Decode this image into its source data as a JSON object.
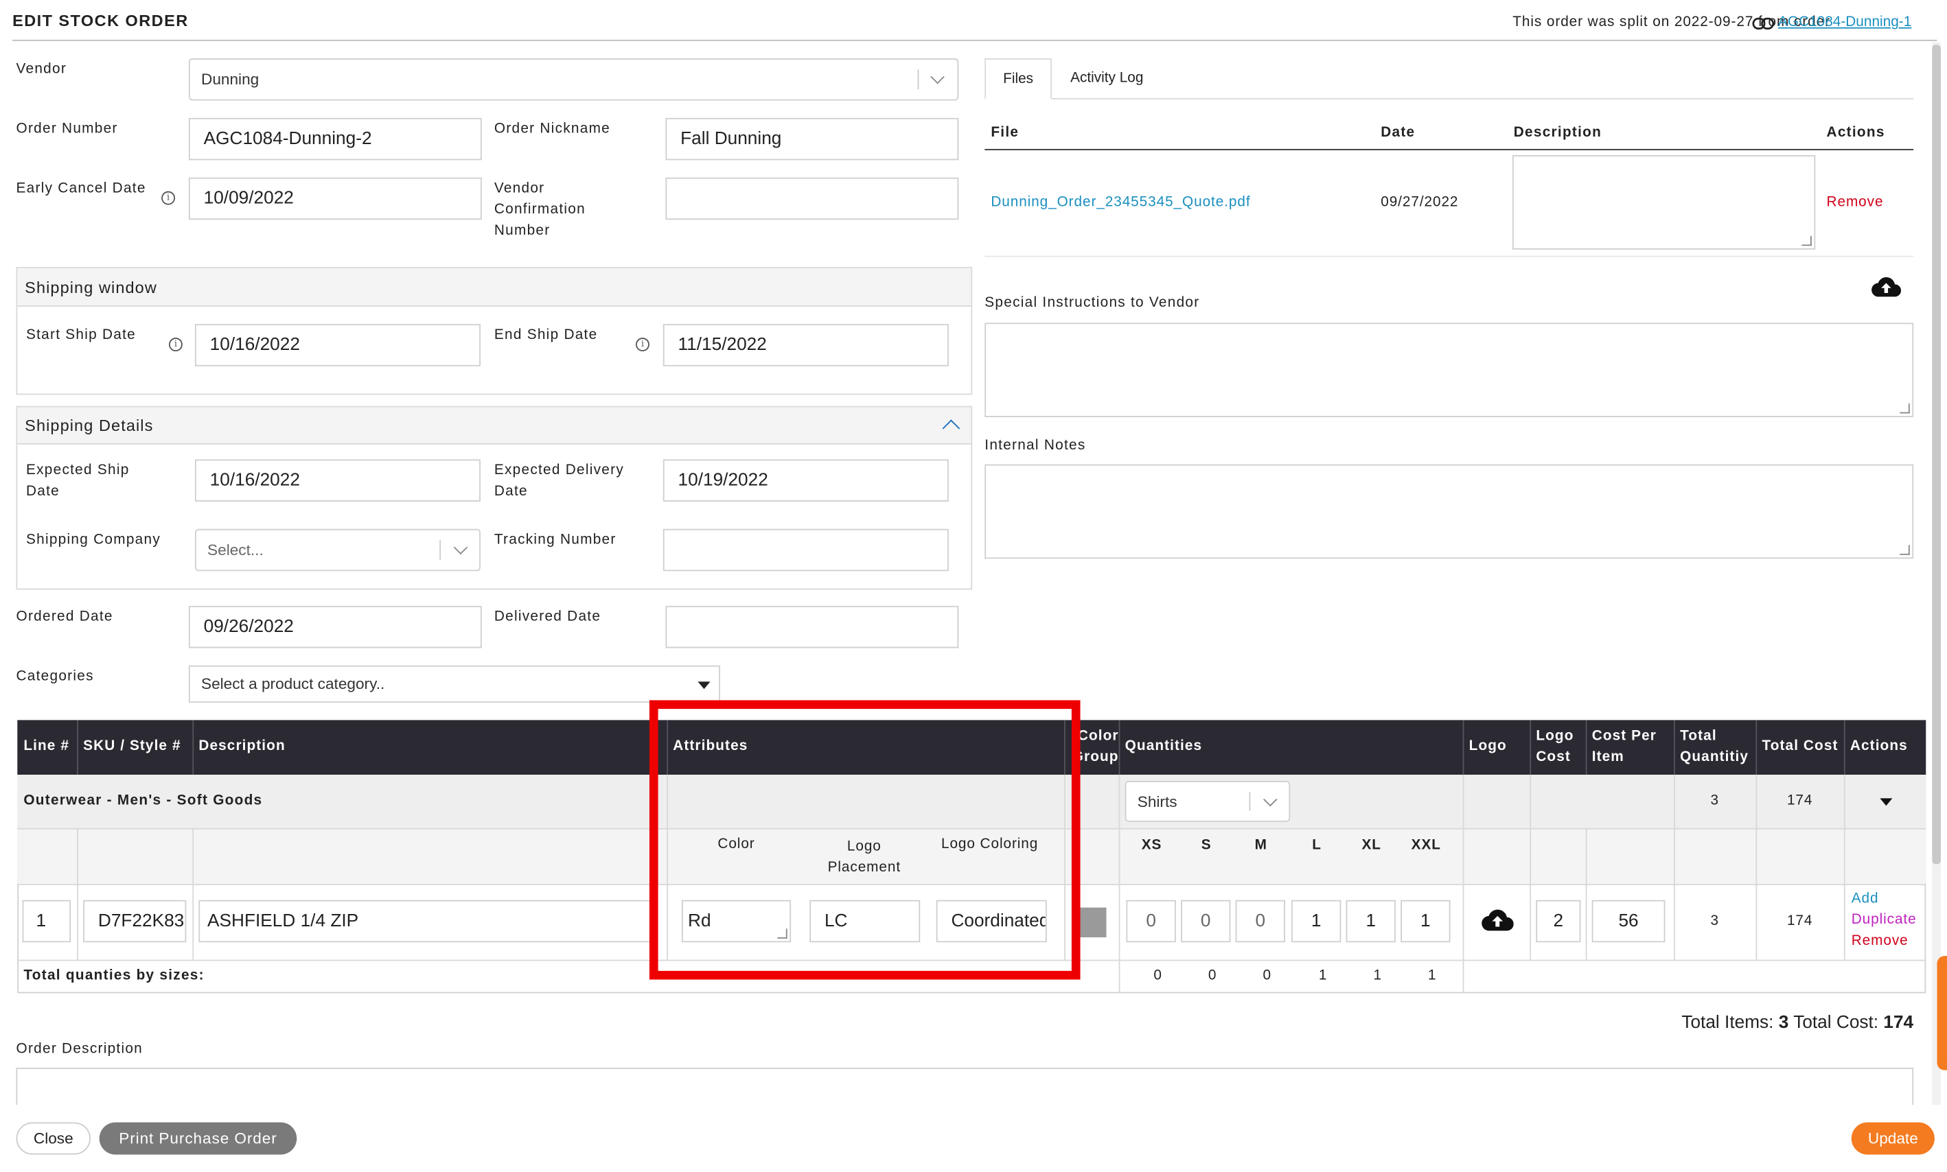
{
  "header": {
    "title": "EDIT STOCK ORDER",
    "split_text": "This order was split on 2022-09-27 from order",
    "split_link": "AGC1084-Dunning-1"
  },
  "form": {
    "vendor_label": "Vendor",
    "vendor_value": "Dunning",
    "order_number_label": "Order Number",
    "order_number_value": "AGC1084-Dunning-2",
    "order_nickname_label": "Order Nickname",
    "order_nickname_value": "Fall Dunning",
    "early_cancel_label": "Early Cancel Date",
    "early_cancel_value": "10/09/2022",
    "vendor_conf_label_1": "Vendor",
    "vendor_conf_label_2": "Confirmation",
    "vendor_conf_label_3": "Number",
    "vendor_conf_value": "",
    "shipping_window": {
      "title": "Shipping window",
      "start_label": "Start Ship Date",
      "start_value": "10/16/2022",
      "end_label": "End Ship Date",
      "end_value": "11/15/2022"
    },
    "shipping_details": {
      "title": "Shipping Details",
      "expected_ship_label_1": "Expected Ship",
      "expected_ship_label_2": "Date",
      "expected_ship_value": "10/16/2022",
      "expected_delivery_label_1": "Expected Delivery",
      "expected_delivery_label_2": "Date",
      "expected_delivery_value": "10/19/2022",
      "shipping_company_label": "Shipping Company",
      "shipping_company_placeholder": "Select...",
      "tracking_label": "Tracking Number",
      "tracking_value": ""
    },
    "ordered_date_label": "Ordered Date",
    "ordered_date_value": "09/26/2022",
    "delivered_date_label": "Delivered Date",
    "delivered_date_value": "",
    "categories_label": "Categories",
    "categories_placeholder": "Select a product category.."
  },
  "files": {
    "tabs": [
      "Files",
      "Activity Log"
    ],
    "columns": [
      "File",
      "Date",
      "Description",
      "Actions"
    ],
    "rows": [
      {
        "file": "Dunning_Order_23455345_Quote.pdf",
        "date": "09/27/2022",
        "description": "",
        "action": "Remove"
      }
    ],
    "special_instructions_label": "Special Instructions to Vendor",
    "internal_notes_label": "Internal Notes"
  },
  "table": {
    "headers": {
      "line": "Line #",
      "sku": "SKU / Style #",
      "description": "Description",
      "attributes": "Attributes",
      "color_group_1": "Color",
      "color_group_2": "Group",
      "quantities": "Quantities",
      "logo": "Logo",
      "logo_cost_1": "Logo",
      "logo_cost_2": "Cost",
      "cost_per_item_1": "Cost Per",
      "cost_per_item_2": "Item",
      "total_qty_1": "Total",
      "total_qty_2": "Quantitiy",
      "total_cost": "Total Cost",
      "actions": "Actions"
    },
    "group": {
      "name": "Outerwear - Men's - Soft Goods",
      "size_select": "Shirts",
      "total_qty": "3",
      "total_cost": "174"
    },
    "attr_headers": [
      "Color",
      "Logo Placement",
      "Logo Coloring"
    ],
    "sizes": [
      "XS",
      "S",
      "M",
      "L",
      "XL",
      "XXL"
    ],
    "row": {
      "line": "1",
      "sku": "D7F22K83",
      "description": "ASHFIELD 1/4 ZIP",
      "color": "Rd",
      "logo_placement": "LC",
      "logo_coloring": "Coordinated",
      "color_swatch": "#9a9a9a",
      "quantities": [
        "0",
        "0",
        "0",
        "1",
        "1",
        "1"
      ],
      "logo_cost": "2",
      "cost_per_item": "56",
      "total_qty": "3",
      "total_cost": "174",
      "actions": [
        "Add",
        "Duplicate",
        "Remove"
      ]
    },
    "totals_label": "Total quanties by sizes:",
    "totals": [
      "0",
      "0",
      "0",
      "1",
      "1",
      "1"
    ]
  },
  "summary": {
    "items_label": "Total Items:",
    "items_value": "3",
    "cost_label": "Total Cost:",
    "cost_value": "174"
  },
  "order_description_label": "Order Description",
  "buttons": {
    "close": "Close",
    "print": "Print Purchase Order",
    "update": "Update"
  },
  "colors": {
    "header_dark": "#2b2a33",
    "link": "#1a8fbf",
    "remove": "#d0021b",
    "duplicate": "#c020c0",
    "update": "#f47b20",
    "highlight": "#ee0000"
  }
}
